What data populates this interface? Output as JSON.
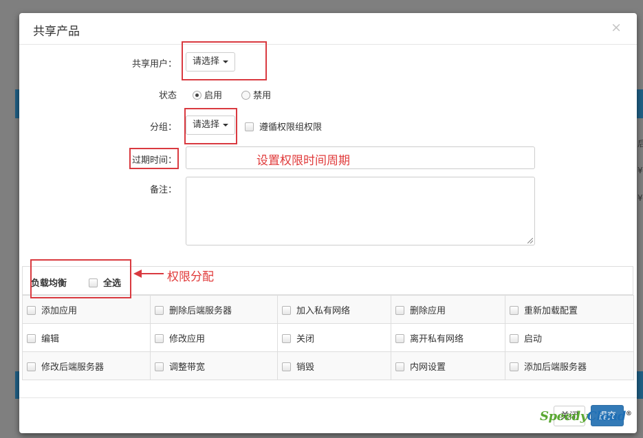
{
  "modal": {
    "title": "共享产品",
    "close_glyph": "×"
  },
  "form": {
    "share_user": {
      "label": "共享用户：",
      "value": "请选择"
    },
    "status": {
      "label": "状态",
      "options": [
        {
          "label": "启用",
          "checked": true
        },
        {
          "label": "禁用",
          "checked": false
        }
      ]
    },
    "group": {
      "label": "分组：",
      "value": "请选择",
      "follow_label": "遵循权限组权限"
    },
    "expire": {
      "label": "过期时间：",
      "value": ""
    },
    "remark": {
      "label": "备注：",
      "value": ""
    }
  },
  "annotations": {
    "expire_note": "设置权限时间周期",
    "perm_note": "权限分配"
  },
  "permissions": {
    "group_title": "负载均衡",
    "select_all": "全选",
    "rows": [
      [
        "添加应用",
        "删除后端服务器",
        "加入私有网络",
        "删除应用",
        "重新加载配置"
      ],
      [
        "编辑",
        "修改应用",
        "关闭",
        "离开私有网络",
        "启动"
      ],
      [
        "修改后端服务器",
        "调整带宽",
        "销毁",
        "内网设置",
        "添加后端服务器"
      ]
    ]
  },
  "footer": {
    "close_label": "关闭",
    "submit_label": "提交"
  },
  "background": {
    "side_chars": [
      "后",
      "¥",
      "¥"
    ]
  },
  "watermark": {
    "part1": "Speedy",
    "part2": "Cloud",
    "mark": "®"
  },
  "colors": {
    "annotation_red": "#d9393f",
    "primary": "#337ab7",
    "overlay": "#7f7f7f"
  }
}
